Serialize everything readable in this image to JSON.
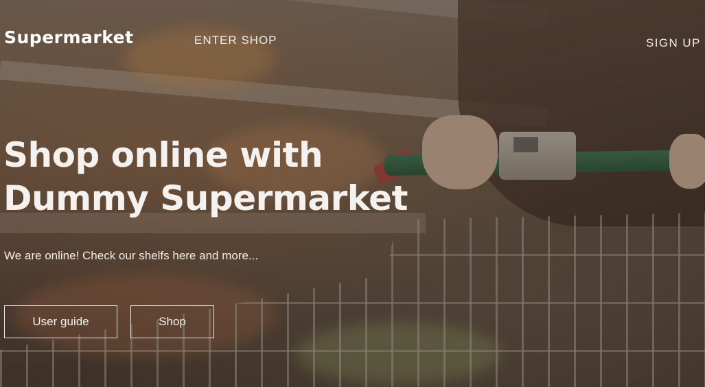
{
  "nav": {
    "brand": "Supermarket",
    "enter_shop": "ENTER SHOP",
    "sign_up": "SIGN UP"
  },
  "hero": {
    "headline_line1": "Shop online with",
    "headline_line2": "Dummy Supermarket",
    "tagline": "We are online! Check our shelfs here and more...",
    "buttons": {
      "user_guide": "User guide",
      "shop": "Shop"
    }
  },
  "colors": {
    "text": "#f4f0ec",
    "overlay": "#281c14",
    "handle_green": "#3f7a58"
  }
}
